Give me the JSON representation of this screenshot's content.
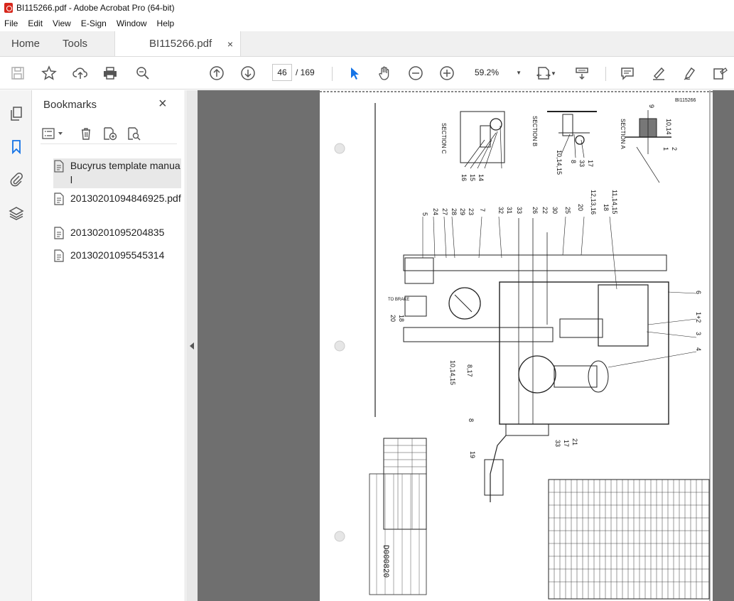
{
  "window": {
    "title": "BI115266.pdf - Adobe Acrobat Pro (64-bit)"
  },
  "menu": [
    "File",
    "Edit",
    "View",
    "E-Sign",
    "Window",
    "Help"
  ],
  "tabs": {
    "home": "Home",
    "tools": "Tools",
    "document": "BI115266.pdf",
    "close": "×"
  },
  "toolbar": {
    "page_current": "46",
    "page_total": "/ 169",
    "zoom": "59.2%"
  },
  "bookmarks": {
    "title": "Bookmarks",
    "close": "×",
    "items": [
      {
        "label": "Bucyrus template manual"
      },
      {
        "label": "20130201094846925.pdf"
      },
      {
        "label": "20130201095204835"
      },
      {
        "label": "20130201095545314"
      }
    ]
  },
  "drawing": {
    "doc_id": "BI115266",
    "section_a": "SECTION A",
    "section_b": "SECTION B",
    "section_c": "SECTION C",
    "to_brake": "TO BRAKE",
    "numbers": [
      "5",
      "24",
      "27",
      "28",
      "29",
      "23",
      "7",
      "32",
      "31",
      "33",
      "26",
      "22",
      "30",
      "25",
      "20",
      "12,13,16",
      "18",
      "11,14,15",
      "9",
      "10,14",
      "1",
      "2",
      "3",
      "4",
      "1+2",
      "6",
      "8",
      "17",
      "33",
      "10,14,15",
      "15",
      "14",
      "16",
      "8,17",
      "10,14,15",
      "21",
      "19",
      "20",
      "18",
      "8",
      "33",
      "17"
    ],
    "drawing_no": "D000820"
  },
  "colors": {
    "accent": "#1473e6",
    "viewer_bg": "#6f6f6f"
  }
}
